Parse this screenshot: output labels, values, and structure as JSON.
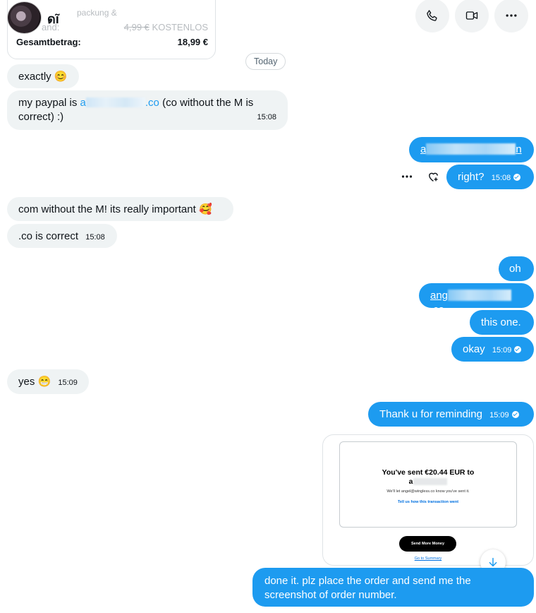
{
  "header": {
    "contact_name": "ดĩ",
    "icons": [
      "phone-icon",
      "video-icon",
      "more-icon"
    ]
  },
  "order": {
    "row1_label": "packung &",
    "row2_label": "and:",
    "row2_strike": "4,99 €",
    "row2_value": "KOSTENLOS",
    "total_label": "Gesamtbetrag:",
    "total_value": "18,99 €"
  },
  "date_divider": "Today",
  "messages": {
    "m1": {
      "text": "exactly",
      "emoji": "😊"
    },
    "m2": {
      "pre": "my paypal is ",
      "link_start": "a",
      "link_end": ".co",
      "post": " (co without the M is",
      "line2": "correct) :)",
      "time": "15:08"
    },
    "m3": {
      "start": "a",
      "end": "n"
    },
    "m4": {
      "text": "right?",
      "time": "15:08"
    },
    "m5": {
      "text": "com without the M! its really important",
      "emoji": "🥰"
    },
    "m6": {
      "text": ".co is correct",
      "time": "15:08"
    },
    "m7": {
      "text": "oh"
    },
    "m8": {
      "start": "ang",
      "end": ".co"
    },
    "m9": {
      "text": "this one."
    },
    "m10": {
      "text": "okay",
      "time": "15:09"
    },
    "m11": {
      "text": "yes",
      "emoji": "😁",
      "time": "15:09"
    },
    "m12": {
      "text": "Thank u for reminding",
      "time": "15:09"
    },
    "m13": {
      "line1": "done it. plz place the order and send me the",
      "line2": "screenshot of order number."
    }
  },
  "attachment": {
    "title_line1": "You've sent €20.44 EUR to",
    "title_line2": "a",
    "note": "We'll let angel@wingless.co know you've sent it.",
    "feedback_link": "Tell us how this transaction went",
    "button_label": "Send More Money",
    "summary_link": "Go to Summary"
  },
  "colors": {
    "outgoing_bubble": "#1d9bf0",
    "incoming_bubble": "#eff3f4",
    "link": "#1d9bf0"
  }
}
